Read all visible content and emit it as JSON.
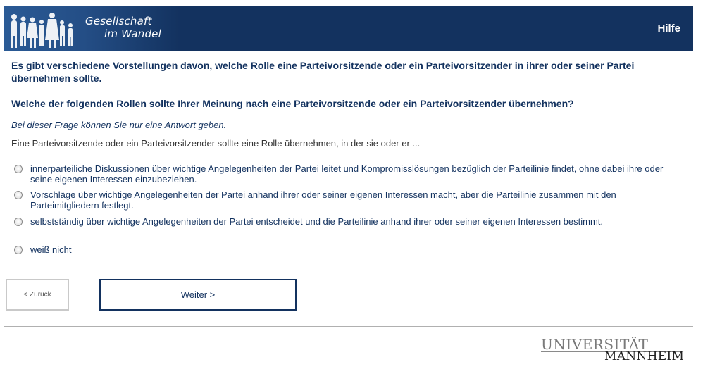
{
  "header": {
    "brand_line1": "Gesellschaft",
    "brand_line2": "im Wandel",
    "help_label": "Hilfe",
    "bg_color": "#13325f"
  },
  "survey": {
    "intro": "Es gibt verschiedene Vorstellungen davon, welche Rolle eine Parteivorsitzende oder ein Parteivorsitzender in ihrer oder seiner Partei übernehmen sollte.",
    "question": "Welche der folgenden Rollen sollte Ihrer Meinung nach eine Parteivorsitzende oder ein Parteivorsitzender übernehmen?",
    "instruction": "Bei dieser Frage können Sie nur eine Antwort geben.",
    "stem": "Eine Parteivorsitzende oder ein Parteivorsitzender sollte eine Rolle übernehmen, in der sie oder er ...",
    "options": [
      {
        "label": "innerparteiliche Diskussionen über wichtige Angelegenheiten der Partei leitet und Kompromisslösungen bezüglich der Parteilinie findet, ohne dabei ihre oder seine eigenen Interessen einzubeziehen.",
        "selected": false
      },
      {
        "label": "Vorschläge über wichtige Angelegenheiten der Partei anhand ihrer oder seiner eigenen Interessen macht, aber die Parteilinie zusammen mit den Parteimitgliedern festlegt.",
        "selected": false
      },
      {
        "label": "selbstständig über wichtige Angelegenheiten der Partei entscheidet und die Parteilinie anhand ihrer oder seiner eigenen Interessen bestimmt.",
        "selected": false
      },
      {
        "label": "weiß nicht",
        "selected": false
      }
    ]
  },
  "nav": {
    "back_label": "< Zurück",
    "next_label": "Weiter >"
  },
  "footer": {
    "logo_line1": "UNIVERSITÄT",
    "logo_line2": "MANNHEIM"
  }
}
